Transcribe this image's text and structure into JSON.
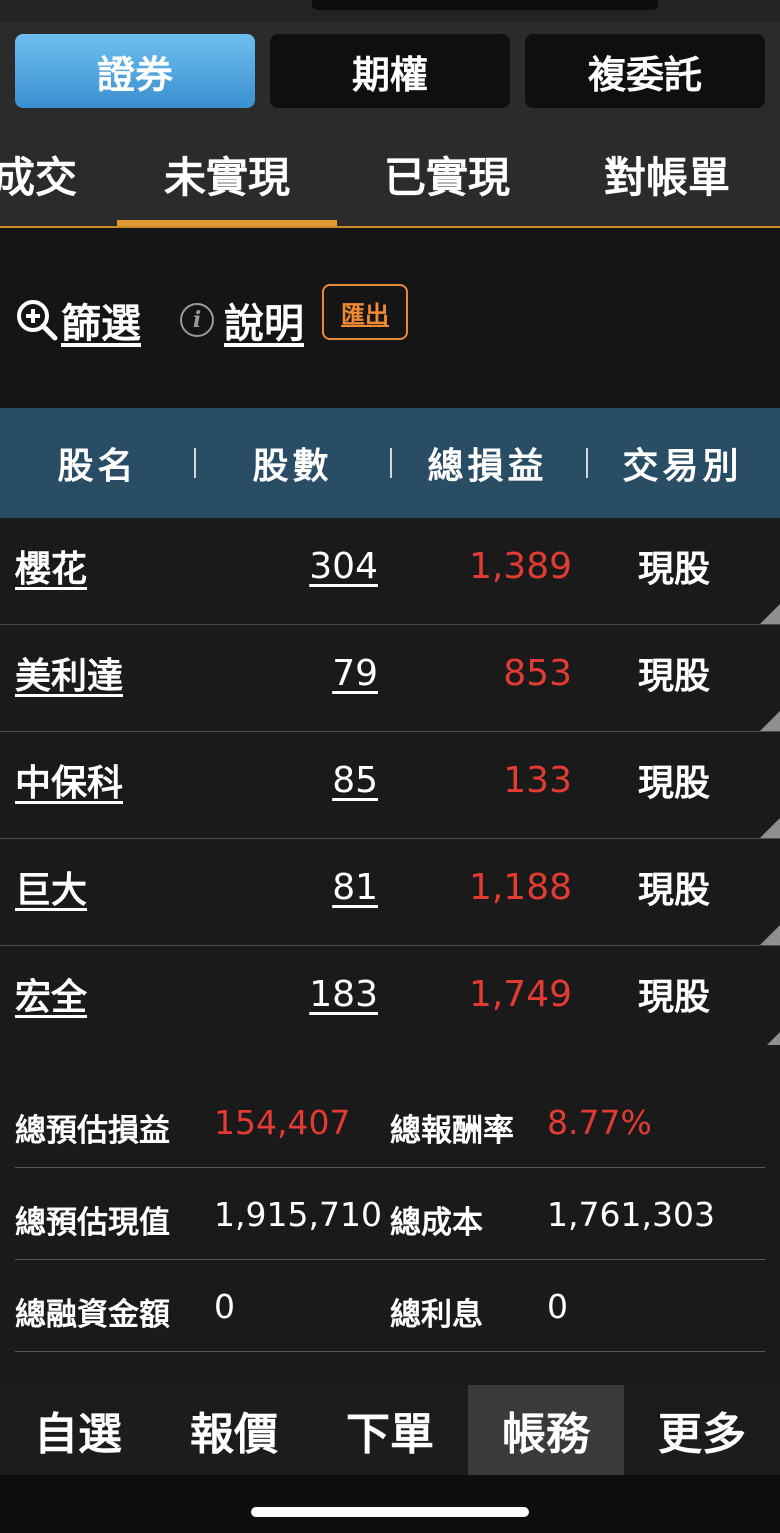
{
  "segments": [
    {
      "label": "證券",
      "active": true
    },
    {
      "label": "期權",
      "active": false
    },
    {
      "label": "複委託",
      "active": false
    }
  ],
  "tabs": [
    {
      "label": "成交",
      "active": false
    },
    {
      "label": "未實現",
      "active": true
    },
    {
      "label": "已實現",
      "active": false
    },
    {
      "label": "對帳單",
      "active": false
    }
  ],
  "toolbar": {
    "filter_label": "篩選",
    "help_label": "說明",
    "export_label": "匯出"
  },
  "table": {
    "headers": [
      "股名",
      "股數",
      "總損益",
      "交易別"
    ],
    "rows": [
      {
        "name": "櫻花",
        "shares": "304",
        "pl": "1,389",
        "type": "現股"
      },
      {
        "name": "美利達",
        "shares": "79",
        "pl": "853",
        "type": "現股"
      },
      {
        "name": "中保科",
        "shares": "85",
        "pl": "133",
        "type": "現股"
      },
      {
        "name": "巨大",
        "shares": "81",
        "pl": "1,188",
        "type": "現股"
      },
      {
        "name": "宏全",
        "shares": "183",
        "pl": "1,749",
        "type": "現股"
      }
    ]
  },
  "summary": {
    "est_pl_label": "總預估損益",
    "est_pl_value": "154,407",
    "return_label": "總報酬率",
    "return_value": "8.77%",
    "est_value_label": "總預估現值",
    "est_value_value": "1,915,710",
    "cost_label": "總成本",
    "cost_value": "1,761,303",
    "margin_label": "總融資金額",
    "margin_value": "0",
    "interest_label": "總利息",
    "interest_value": "0"
  },
  "bottom_nav": [
    {
      "label": "自選",
      "active": false
    },
    {
      "label": "報價",
      "active": false
    },
    {
      "label": "下單",
      "active": false
    },
    {
      "label": "帳務",
      "active": true
    },
    {
      "label": "更多",
      "active": false
    }
  ],
  "colors": {
    "accent_blue": "#4a9fe0",
    "tab_underline": "#e09a34",
    "profit_red": "#e23b33",
    "header_bg": "#2a4d66",
    "export_orange": "#f08a33"
  }
}
